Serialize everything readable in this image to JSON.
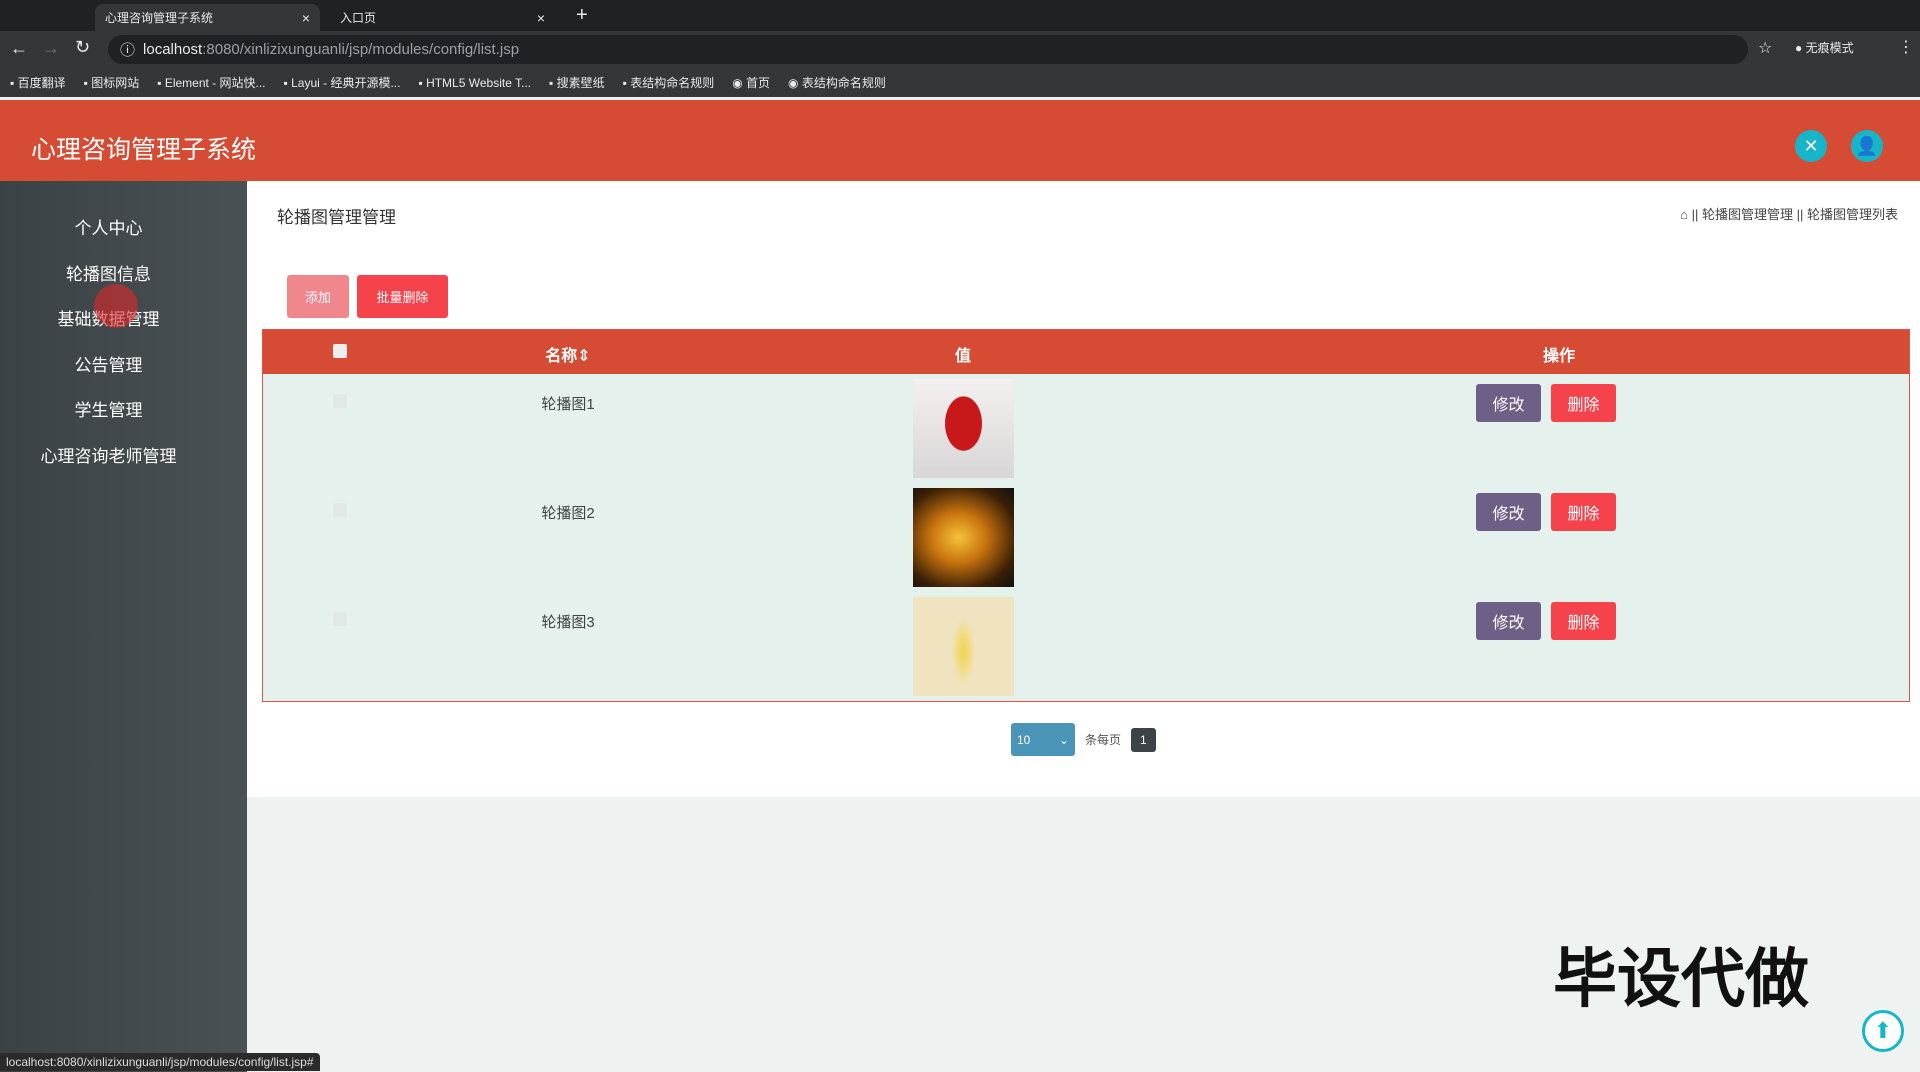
{
  "browser": {
    "tabs": [
      {
        "label": "心理咨询管理子系统",
        "close": "×"
      },
      {
        "label": "入口页",
        "close": "×"
      }
    ],
    "new_tab": "+",
    "url_host": "localhost",
    "url_rest": ":8080/xinlizixunguanli/jsp/modules/config/list.jsp",
    "incognito": "无痕模式",
    "bookmarks": [
      "百度翻译",
      "图标网站",
      "Element - 网站快...",
      "Layui - 经典开源模...",
      "HTML5 Website T...",
      "搜素壁纸",
      "表结构命名规则",
      "首页",
      "表结构命名规则"
    ]
  },
  "header": {
    "title": "心理咨询管理子系统"
  },
  "sidebar": {
    "items": [
      "个人中心",
      "轮播图信息",
      "基础数据管理",
      "公告管理",
      "学生管理",
      "心理咨询老师管理"
    ]
  },
  "main": {
    "title": "轮播图管理管理",
    "breadcrumb": [
      "轮播图管理管理",
      "轮播图管理列表"
    ],
    "breadcrumb_sep": "||",
    "add_label": "添加",
    "batch_delete_label": "批量删除",
    "columns": {
      "name": "名称",
      "name_sort": "⇕",
      "value": "值",
      "actions": "操作"
    },
    "rows": [
      {
        "name": "轮播图1"
      },
      {
        "name": "轮播图2"
      },
      {
        "name": "轮播图3"
      }
    ],
    "edit_label": "修改",
    "delete_label": "删除",
    "pager": {
      "page_size": "10",
      "per_page_label": "条每页",
      "current_page": "1"
    }
  },
  "watermark": "毕设代做",
  "status_url": "localhost:8080/xinlizixunguanli/jsp/modules/config/list.jsp#"
}
